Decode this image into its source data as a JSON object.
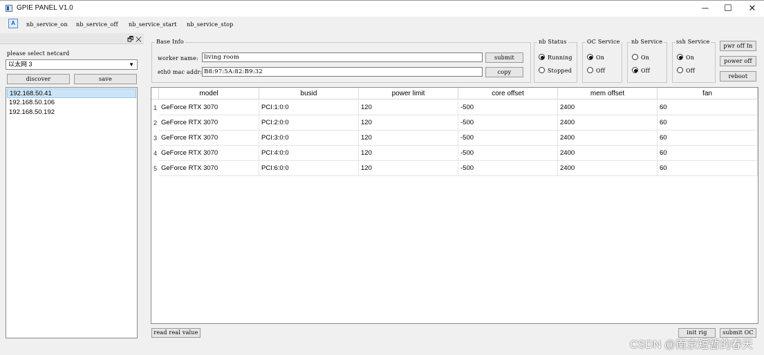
{
  "window": {
    "title": "GPIE PANEL V1.0",
    "minimize": "─",
    "maximize": "☐",
    "close": "✕"
  },
  "toolbar": {
    "icon_text": "A",
    "items": [
      "nb_service_on",
      "nb_service_off",
      "nb_service_start",
      "nb_service_stop"
    ]
  },
  "dock": {
    "float_icon": "🗗",
    "close_icon": "✕"
  },
  "netcard": {
    "label": "please select netcard",
    "selected": "以太网 3"
  },
  "buttons": {
    "discover": "discover",
    "save": "save",
    "submit": "submit",
    "copy": "copy",
    "pwr_off_in": "pwr off In",
    "power_off": "power off",
    "reboot": "reboot",
    "read_real_value": "read real value",
    "init_rig": "init rig",
    "submit_oc": "submit OC"
  },
  "ip_list": [
    "192.168.50.41",
    "192.168.50.106",
    "192.168.50.192"
  ],
  "base_info": {
    "title": "Base Info",
    "worker_label": "worker name:",
    "worker_value": "living room",
    "mac_label": "eth0 mac addr:",
    "mac_value": "B8:97:5A:82:B9:32"
  },
  "nb_status": {
    "title": "nb Status",
    "running": "Running",
    "stopped": "Stopped"
  },
  "oc_service": {
    "title": "OC Service",
    "on": "On",
    "off": "Off"
  },
  "nb_service": {
    "title": "nb Service",
    "on": "On",
    "off": "Off"
  },
  "ssh_service": {
    "title": "ssh Service",
    "on": "On",
    "off": "Off"
  },
  "table": {
    "columns": [
      "model",
      "busid",
      "power limit",
      "core offset",
      "mem offset",
      "fan"
    ],
    "rows": [
      [
        "1",
        "GeForce RTX 3070",
        "PCI:1:0:0",
        "120",
        "-500",
        "2400",
        "60"
      ],
      [
        "2",
        "GeForce RTX 3070",
        "PCI:2:0:0",
        "120",
        "-500",
        "2400",
        "60"
      ],
      [
        "3",
        "GeForce RTX 3070",
        "PCI:3:0:0",
        "120",
        "-500",
        "2400",
        "60"
      ],
      [
        "4",
        "GeForce RTX 3070",
        "PCI:4:0:0",
        "120",
        "-500",
        "2400",
        "60"
      ],
      [
        "5",
        "GeForce RTX 3070",
        "PCI:6:0:0",
        "120",
        "-500",
        "2400",
        "60"
      ]
    ]
  },
  "watermark": "CSDN @南京短暂的春天"
}
